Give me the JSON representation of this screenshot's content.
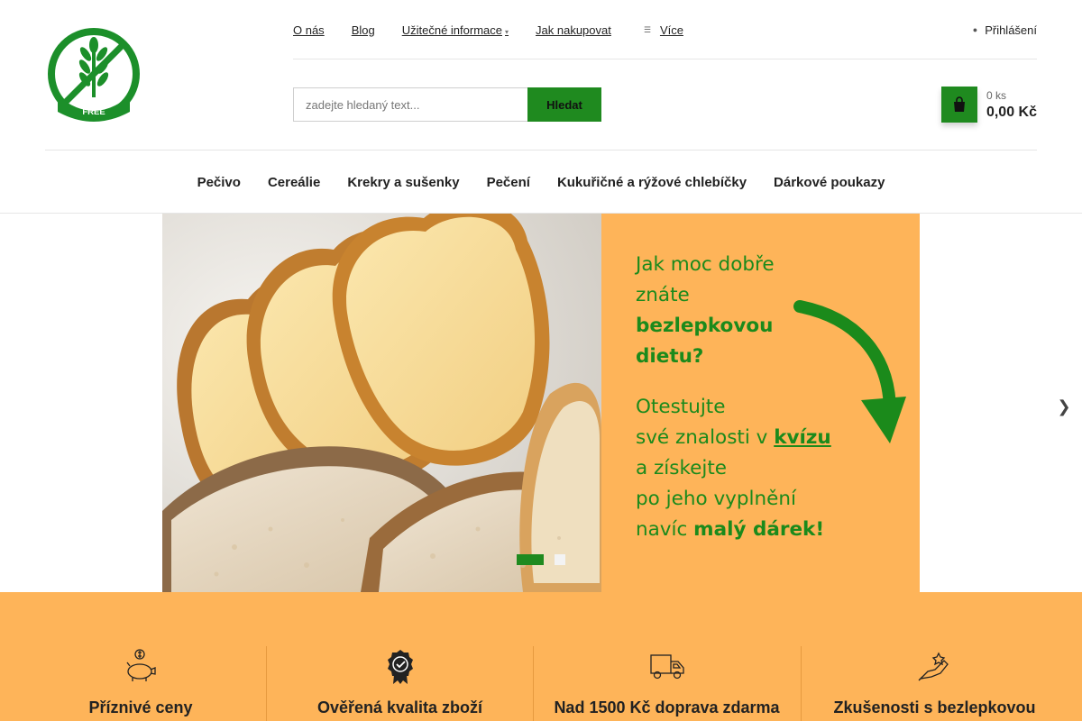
{
  "header": {
    "logo_text_top": "GLUTEN",
    "logo_text_bottom": "FREE",
    "top_links": [
      "O nás",
      "Blog",
      "Užitečné informace",
      "Jak nakupovat"
    ],
    "more_label": "Více",
    "login_label": "Přihlášení",
    "search": {
      "placeholder": "zadejte hledaný text...",
      "button_label": "Hledat"
    },
    "cart": {
      "count": "0 ks",
      "total": "0,00 Kč"
    }
  },
  "main_nav": [
    "Pečivo",
    "Cereálie",
    "Krekry a sušenky",
    "Pečení",
    "Kukuřičné a rýžové chlebíčky",
    "Dárkové poukazy"
  ],
  "banner": {
    "line1": "Jak moc dobře",
    "line2": "znáte",
    "line3": "bezlepkovou",
    "line4": "dietu?",
    "line5": "Otestujte",
    "line6_prefix": "své znalosti v",
    "line6_link": "kvízu",
    "line7": "a získejte",
    "line8": "po jeho vyplnění",
    "line9_prefix": "navíc",
    "line9_bold": "malý dárek!"
  },
  "benefits": [
    {
      "icon": "piggy-bank-icon",
      "title": "Příznivé ceny"
    },
    {
      "icon": "quality-badge-icon",
      "title": "Ověřená kvalita zboží"
    },
    {
      "icon": "delivery-truck-icon",
      "title": "Nad 1500 Kč doprava zdarma"
    },
    {
      "icon": "experience-hand-icon",
      "title": "Zkušenosti s bezlepkovou"
    }
  ],
  "colors": {
    "accent_green": "#1f8a1f",
    "banner_orange": "#feb459",
    "banner_text_green": "#1b8a1b"
  }
}
